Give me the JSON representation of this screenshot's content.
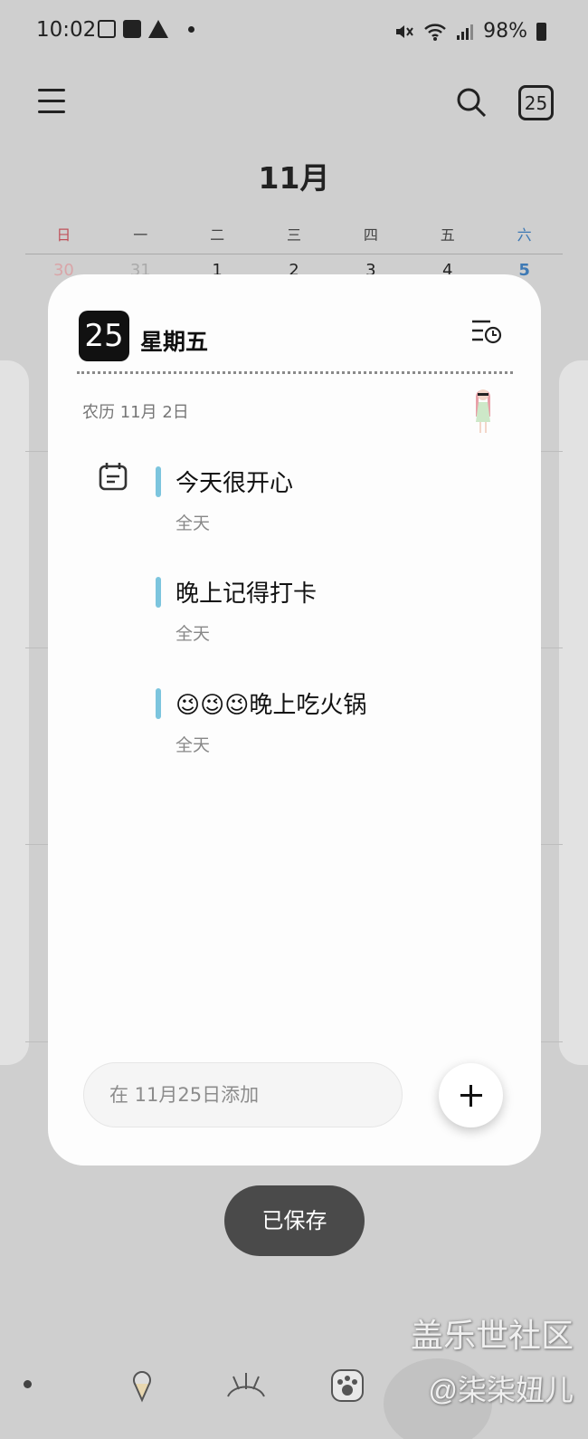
{
  "status_bar": {
    "time": "10:02",
    "battery": "98%",
    "icons": [
      "image-icon",
      "messenger-icon",
      "warning-icon",
      "dot-icon",
      "mute-icon",
      "wifi-icon",
      "signal-icon",
      "battery-icon"
    ]
  },
  "header": {
    "month": "11月",
    "today_badge": "25"
  },
  "weekdays": [
    "日",
    "一",
    "二",
    "三",
    "四",
    "五",
    "六"
  ],
  "first_week": [
    "30",
    "31",
    "1",
    "2",
    "3",
    "4",
    "5"
  ],
  "day_card": {
    "day_number": "25",
    "day_name": "星期五",
    "lunar_date": "农历 11月 2日",
    "events": [
      {
        "title": "今天很开心",
        "sub": "全天",
        "color": "#7cc5de"
      },
      {
        "title": "晚上记得打卡",
        "sub": "全天",
        "color": "#7cc5de"
      },
      {
        "title": "😉😉😉晚上吃火锅",
        "sub": "全天",
        "color": "#7cc5de"
      }
    ],
    "add_placeholder": "在 11月25日添加"
  },
  "toast": "已保存",
  "watermark": {
    "line1": "盖乐世社区",
    "line2": "@柒柒妞儿"
  },
  "colors": {
    "sunday": "#c0525b",
    "saturday": "#3f7ab5",
    "event_bar": "#7cc5de"
  }
}
